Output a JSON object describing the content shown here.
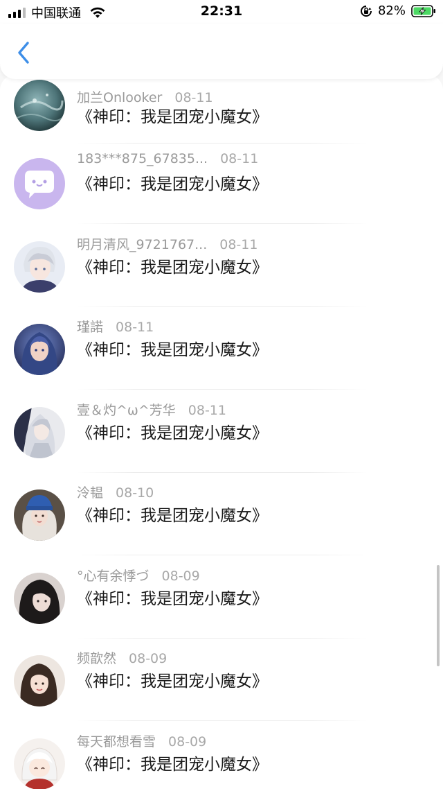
{
  "status_bar": {
    "carrier": "中国联通",
    "time": "22:31",
    "battery_percent": "82%",
    "icons": [
      "signal-icon",
      "wifi-icon",
      "rotation-lock-icon",
      "battery-charging-icon"
    ]
  },
  "nav": {
    "back_icon": "chevron-left-icon",
    "accent_color": "#3d8ee8"
  },
  "list": {
    "items": [
      {
        "user": "加兰Onlooker",
        "date": "08-11",
        "book": "《神印：我是团宠小魔女》",
        "avatar": "underwater-photo"
      },
      {
        "user": "183***875_67835...",
        "date": "08-11",
        "book": "《神印：我是团宠小魔女》",
        "avatar": "chat-bubble-default"
      },
      {
        "user": "明月清风_9721767...",
        "date": "08-11",
        "book": "《神印：我是团宠小魔女》",
        "avatar": "anime-boy"
      },
      {
        "user": "瑾諾",
        "date": "08-11",
        "book": "《神印：我是团宠小魔女》",
        "avatar": "fantasy-girl"
      },
      {
        "user": "壹＆灼^ω^芳华",
        "date": "08-11",
        "book": "《神印：我是团宠小魔女》",
        "avatar": "silver-hair-anime"
      },
      {
        "user": "泠韫",
        "date": "08-10",
        "book": "《神印：我是团宠小魔女》",
        "avatar": "girl-blue-beanie"
      },
      {
        "user": "°心有余悸づ",
        "date": "08-09",
        "book": "《神印：我是团宠小魔女》",
        "avatar": "dark-hair-girl"
      },
      {
        "user": "频歆然",
        "date": "08-09",
        "book": "《神印：我是团宠小魔女》",
        "avatar": "girl-selfie"
      },
      {
        "user": "每天都想看雪",
        "date": "08-09",
        "book": "《神印：我是团宠小魔女》",
        "avatar": "chibi-girl-red-hood"
      }
    ]
  }
}
